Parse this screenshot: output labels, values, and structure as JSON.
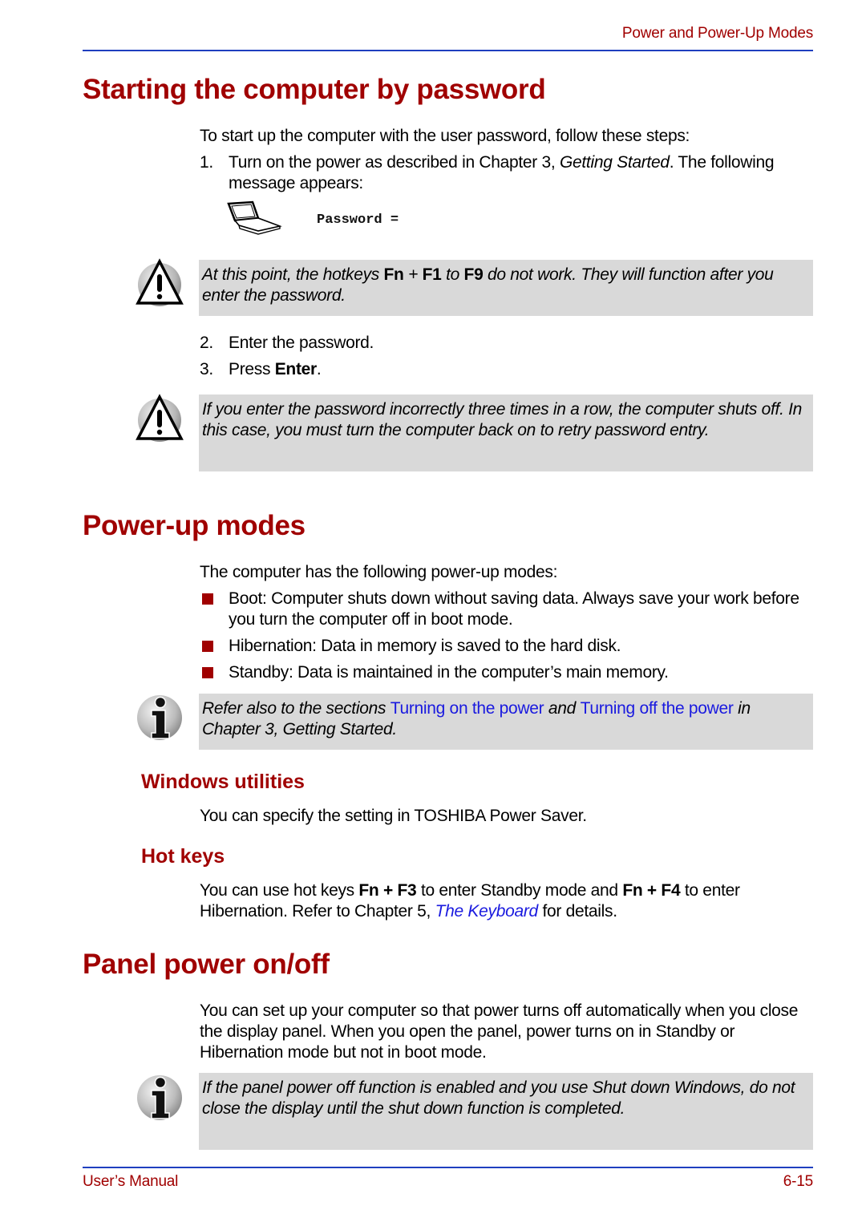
{
  "header": {
    "running_title": "Power and Power-Up Modes"
  },
  "section_password": {
    "title": "Starting the computer by password",
    "intro": "To start up the computer with the user password, follow these steps:",
    "steps": [
      {
        "num": "1.",
        "text_before": "Turn on the power as described in Chapter 3, ",
        "text_italic": "Getting Started",
        "text_after": ". The following message appears:"
      },
      {
        "num": "2.",
        "text": "Enter the password."
      },
      {
        "num": "3.",
        "text_before": "Press ",
        "text_bold": "Enter",
        "text_after": "."
      }
    ],
    "screen_message": "Password =",
    "caution_1": {
      "icon": "warning-icon",
      "p1": "At this point, the hotkeys ",
      "b1": "Fn",
      "p2": " + ",
      "b2": "F1",
      "p3": " to ",
      "b3": "F9",
      "p4": " do not work. They will function after you enter the password."
    },
    "caution_2": {
      "icon": "warning-icon",
      "text": "If you enter the password incorrectly three times in a row, the computer shuts off. In this case, you must turn the computer back on to retry password entry."
    }
  },
  "section_powerup": {
    "title": "Power-up modes",
    "intro": "The computer has the following power-up modes:",
    "bullets": [
      "Boot: Computer shuts down without saving data. Always save your work before you turn the computer off in boot mode.",
      "Hibernation: Data in memory is saved to the hard disk.",
      "Standby: Data is maintained in the computer’s main memory."
    ],
    "note": {
      "icon": "info-icon",
      "p1": "Refer also to the sections ",
      "link1": "Turning on the power",
      "p2": " and ",
      "link2": "Turning off the power",
      "p3": " in Chapter 3, Getting Started."
    },
    "windows_utilities": {
      "title": "Windows utilities",
      "text": "You can specify the setting in TOSHIBA Power Saver."
    },
    "hot_keys": {
      "title": "Hot keys",
      "p1": "You can use hot keys ",
      "b1": "Fn + F3",
      "p2": " to enter Standby mode and ",
      "b2": "Fn + F4",
      "p3": " to enter Hibernation. Refer to Chapter 5, ",
      "link": "The Keyboard",
      "p4": " for details."
    }
  },
  "section_panel": {
    "title": "Panel power on/off",
    "text": "You can set up your computer so that power turns off automatically when you close the display panel. When you open the panel, power turns on in Standby or Hibernation mode but not in boot mode.",
    "note": {
      "icon": "info-icon",
      "text": "If the panel power off function is enabled and you use Shut down Windows, do not close the display until the shut down function is completed."
    }
  },
  "footer": {
    "left": "User’s Manual",
    "right": "6-15"
  },
  "colors": {
    "heading": "#a00000",
    "rule": "#1f3fbf",
    "note_bg": "#d9d9d9",
    "link": "#1a1adf"
  }
}
